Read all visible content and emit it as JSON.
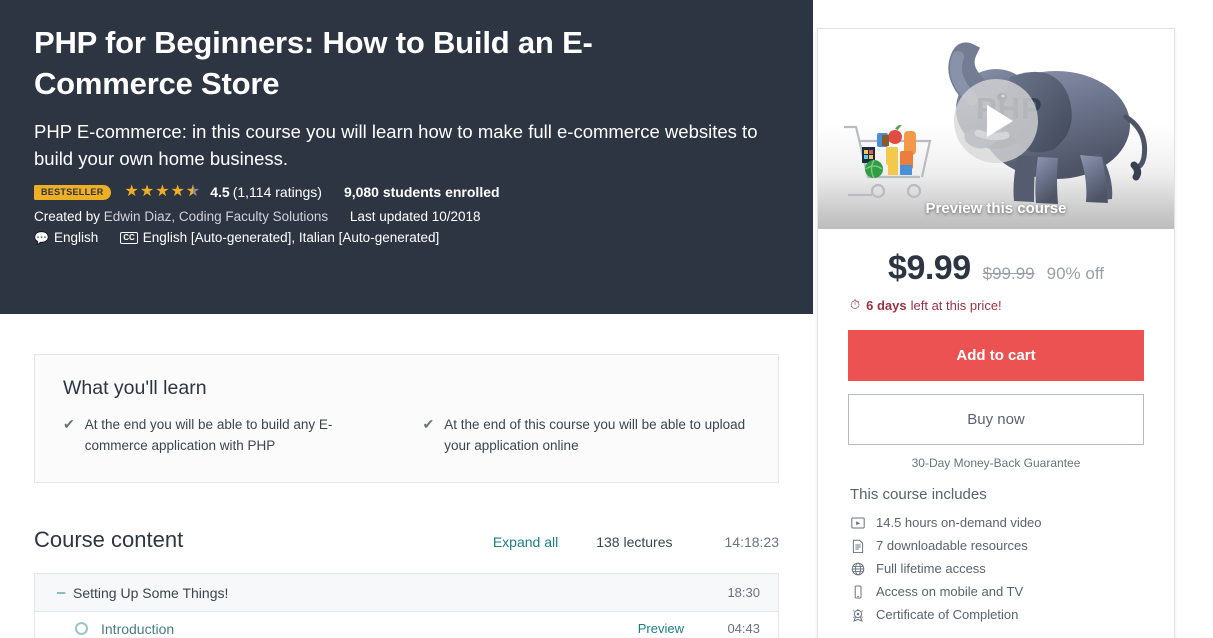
{
  "hero": {
    "title": "PHP for Beginners: How to Build an E-Commerce Store",
    "subtitle": "PHP E-commerce: in this course you will learn how to make full e-commerce websites to build your own home business.",
    "bestseller_badge": "BESTSELLER",
    "rating_value": "4.5",
    "rating_count": "(1,114 ratings)",
    "students_enrolled": "9,080 students enrolled",
    "created_by_prefix": "Created by ",
    "authors": "Edwin Diaz, Coding Faculty Solutions",
    "last_updated": "Last updated 10/2018",
    "language": "English",
    "cc_badge": "CC",
    "captions": "English [Auto-generated], Italian [Auto-generated]",
    "stars": [
      "full",
      "full",
      "full",
      "full",
      "half"
    ],
    "accent_gold": "#EEAF24",
    "hero_bg": "#2D3442"
  },
  "learn": {
    "title": "What you'll learn",
    "items": [
      "At the end you will be able to build any E-commerce application with PHP",
      "At the end of this course you will be able to upload your application online"
    ]
  },
  "course_content": {
    "title": "Course content",
    "expand_all": "Expand all",
    "lectures": "138 lectures",
    "duration": "14:18:23",
    "sections": [
      {
        "toggle": "–",
        "name": "Setting Up Some Things!",
        "time": "18:30",
        "lectures": [
          {
            "name": "Introduction",
            "preview": "Preview",
            "time": "04:43"
          }
        ]
      }
    ]
  },
  "buy_card": {
    "preview_label": "Preview this course",
    "php_watermark": "PHP",
    "price_now": "$9.99",
    "price_old": "$99.99",
    "discount": "90% off",
    "deadline_bold": "6 days",
    "deadline_rest": "left at this price!",
    "add_to_cart": "Add to cart",
    "buy_now": "Buy now",
    "guarantee": "30-Day Money-Back Guarantee",
    "includes_title": "This course includes",
    "includes": [
      {
        "icon": "video-icon",
        "glyph": "▣",
        "label": "14.5 hours on-demand video"
      },
      {
        "icon": "document-icon",
        "glyph": "▤",
        "label": "7 downloadable resources"
      },
      {
        "icon": "globe-icon",
        "glyph": "◉",
        "label": "Full lifetime access"
      },
      {
        "icon": "mobile-icon",
        "glyph": "▯",
        "label": "Access on mobile and TV"
      },
      {
        "icon": "certificate-icon",
        "glyph": "✹",
        "label": "Certificate of Completion"
      }
    ],
    "cta_color": "#EC5252",
    "link_color": "#1a7f84"
  }
}
